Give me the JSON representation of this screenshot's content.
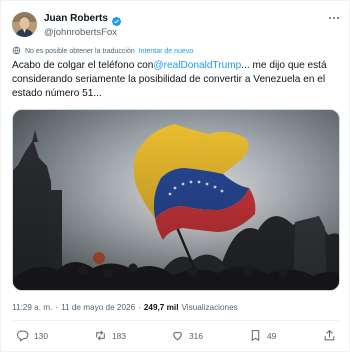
{
  "author": {
    "display_name": "Juan Roberts",
    "handle": "@johnrobertsFox"
  },
  "translation": {
    "notice": "No es posible obtener la traducción",
    "retry": "Intentar de nuevo"
  },
  "tweet": {
    "text_before": "Acabo de colgar el teléfono con",
    "mention": "@realDonaldTrump",
    "text_after": "... me dijo que está considerando seriamente la posibilidad de convertir a Venezuela en el estado número 51..."
  },
  "meta": {
    "time": "11:29 a. m.",
    "separator": "·",
    "date": "11 de mayo de 2026",
    "views_count": "249,7 mil",
    "views_label": "Visualizaciones"
  },
  "actions": {
    "replies": "130",
    "reposts": "183",
    "likes": "316",
    "bookmarks": "49"
  },
  "colors": {
    "accent": "#1d9bf0",
    "text": "#0f1419",
    "muted": "#536471",
    "flag_yellow": "#f2c230",
    "flag_blue": "#2a4c9c",
    "flag_red": "#d8383d"
  },
  "icons": [
    "verified-badge-icon",
    "more-icon",
    "translate-icon",
    "reply-icon",
    "repost-icon",
    "like-icon",
    "bookmark-icon",
    "share-icon"
  ]
}
